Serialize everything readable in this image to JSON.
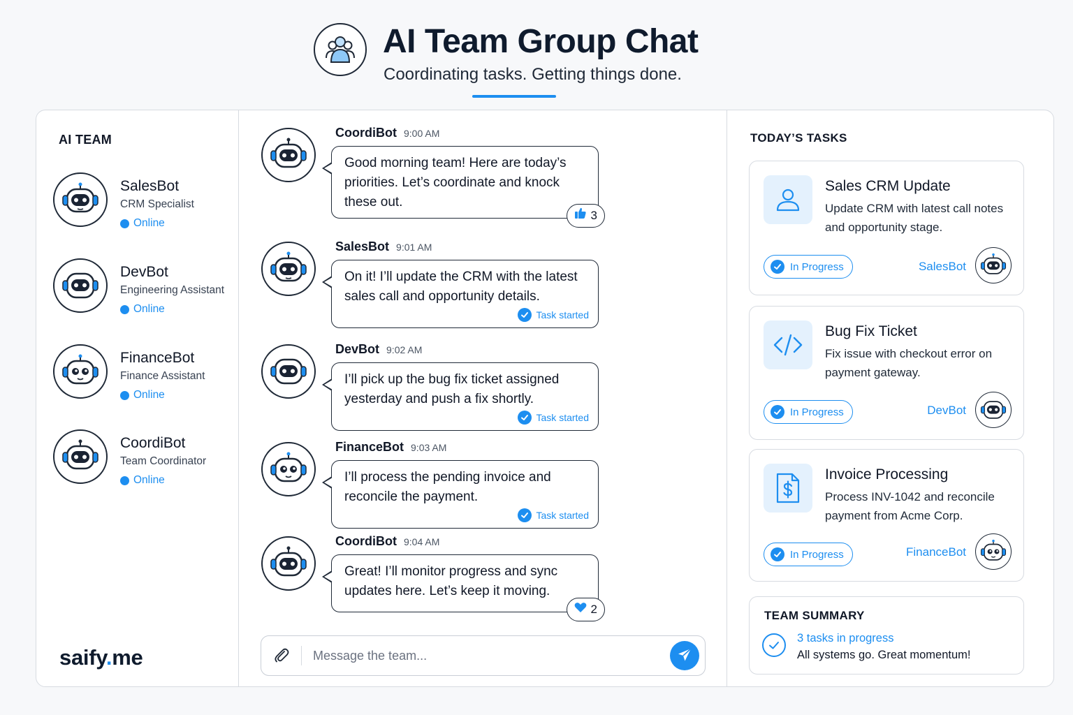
{
  "header": {
    "title": "AI Team Group Chat",
    "subtitle": "Coordinating tasks. Getting things done.",
    "icon": "team-people-icon"
  },
  "sidebar": {
    "title": "AI TEAM",
    "members": [
      {
        "name": "SalesBot",
        "role": "CRM Specialist",
        "status": "Online",
        "icon": "robot-headset-icon"
      },
      {
        "name": "DevBot",
        "role": "Engineering Assistant",
        "status": "Online",
        "icon": "robot-headset-icon"
      },
      {
        "name": "FinanceBot",
        "role": "Finance Assistant",
        "status": "Online",
        "icon": "robot-round-eyes-icon"
      },
      {
        "name": "CoordiBot",
        "role": "Team Coordinator",
        "status": "Online",
        "icon": "robot-headset-icon"
      }
    ],
    "brand_name": "saify",
    "brand_dot": ".",
    "brand_tld": "me"
  },
  "chat": {
    "messages": [
      {
        "sender": "CoordiBot",
        "time": "9:00 AM",
        "text": "Good morning team! Here are today’s priorities. Let’s coordinate and knock these out.",
        "reaction_icon": "thumbs-up-icon",
        "reaction_count": "3"
      },
      {
        "sender": "SalesBot",
        "time": "9:01 AM",
        "text": "On it! I’ll update the CRM with the latest sales call and opportunity details.",
        "status": "Task started"
      },
      {
        "sender": "DevBot",
        "time": "9:02 AM",
        "text": "I’ll pick up the bug fix ticket assigned yesterday and push a fix shortly.",
        "status": "Task started"
      },
      {
        "sender": "FinanceBot",
        "time": "9:03 AM",
        "text": "I’ll process the pending invoice and reconcile the payment.",
        "status": "Task started"
      },
      {
        "sender": "CoordiBot",
        "time": "9:04 AM",
        "text": "Great! I’ll monitor progress and sync updates here. Let’s keep it moving.",
        "reaction_icon": "heart-icon",
        "reaction_count": "2"
      }
    ],
    "composer": {
      "placeholder": "Message the team...",
      "attach_icon": "paperclip-icon",
      "send_icon": "paper-plane-icon"
    }
  },
  "tasks": {
    "title": "TODAY’S TASKS",
    "items": [
      {
        "title": "Sales CRM Update",
        "description": "Update CRM with latest call notes and opportunity stage.",
        "status": "In Progress",
        "assignee": "SalesBot",
        "icon": "user-icon"
      },
      {
        "title": "Bug Fix Ticket",
        "description": "Fix issue with checkout error on payment gateway.",
        "status": "In Progress",
        "assignee": "DevBot",
        "icon": "code-icon"
      },
      {
        "title": "Invoice Processing",
        "description": "Process INV-1042 and reconcile payment from Acme Corp.",
        "status": "In Progress",
        "assignee": "FinanceBot",
        "icon": "invoice-dollar-icon"
      }
    ],
    "summary": {
      "title": "TEAM SUMMARY",
      "line1": "3 tasks in progress",
      "line2": "All systems go. Great momentum!",
      "icon": "check-circle-icon"
    }
  },
  "colors": {
    "accent": "#1d8ef0",
    "text": "#111827",
    "border": "#d7dbe1",
    "icon_bg": "#e4f1fd"
  }
}
